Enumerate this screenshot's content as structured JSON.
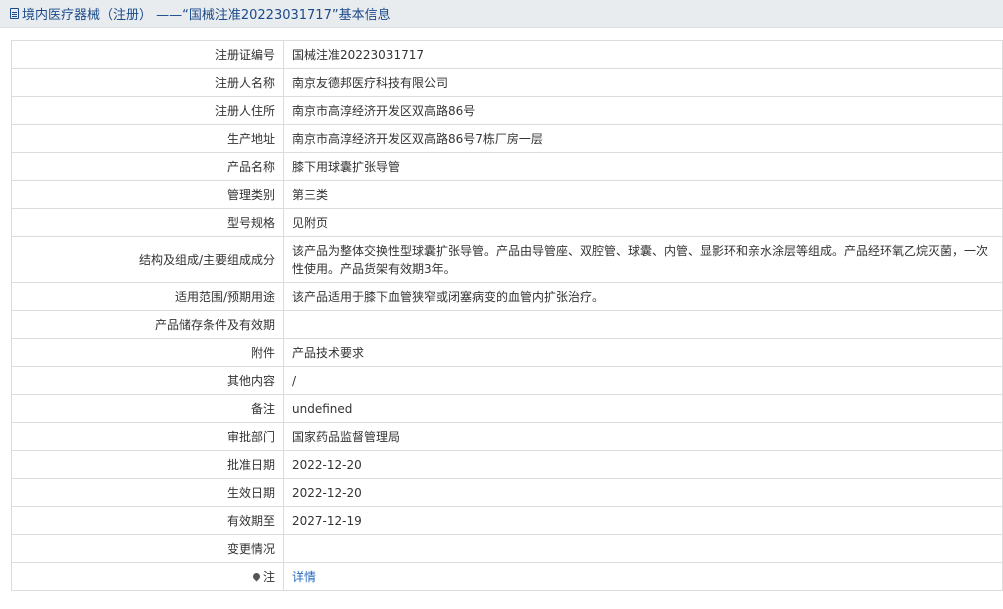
{
  "header": {
    "title": "境内医疗器械（注册） ——“国械注准20223031717”基本信息"
  },
  "rows": [
    {
      "label": "注册证编号",
      "value": "国械注准20223031717"
    },
    {
      "label": "注册人名称",
      "value": "南京友德邦医疗科技有限公司"
    },
    {
      "label": "注册人住所",
      "value": "南京市高淳经济开发区双高路86号"
    },
    {
      "label": "生产地址",
      "value": "南京市高淳经济开发区双高路86号7栋厂房一层"
    },
    {
      "label": "产品名称",
      "value": "膝下用球囊扩张导管"
    },
    {
      "label": "管理类别",
      "value": "第三类"
    },
    {
      "label": "型号规格",
      "value": "见附页"
    },
    {
      "label": "结构及组成/主要组成成分",
      "value": "该产品为整体交换性型球囊扩张导管。产品由导管座、双腔管、球囊、内管、显影环和亲水涂层等组成。产品经环氧乙烷灭菌，一次性使用。产品货架有效期3年。"
    },
    {
      "label": "适用范围/预期用途",
      "value": "该产品适用于膝下血管狭窄或闭塞病变的血管内扩张治疗。"
    },
    {
      "label": "产品储存条件及有效期",
      "value": ""
    },
    {
      "label": "附件",
      "value": "产品技术要求"
    },
    {
      "label": "其他内容",
      "value": "/"
    },
    {
      "label": "备注",
      "value": "undefined"
    },
    {
      "label": "审批部门",
      "value": "国家药品监督管理局"
    },
    {
      "label": "批准日期",
      "value": "2022-12-20"
    },
    {
      "label": "生效日期",
      "value": "2022-12-20"
    },
    {
      "label": "有效期至",
      "value": "2027-12-19"
    },
    {
      "label": "变更情况",
      "value": ""
    },
    {
      "label": "注",
      "value": "详情"
    }
  ],
  "colors": {
    "header_bg": "#e9ecef",
    "header_text": "#1a4a8a",
    "link": "#2a6bbf",
    "border": "#dcdcdc"
  },
  "icons": {
    "header": "document-icon",
    "note": "pin-icon"
  }
}
